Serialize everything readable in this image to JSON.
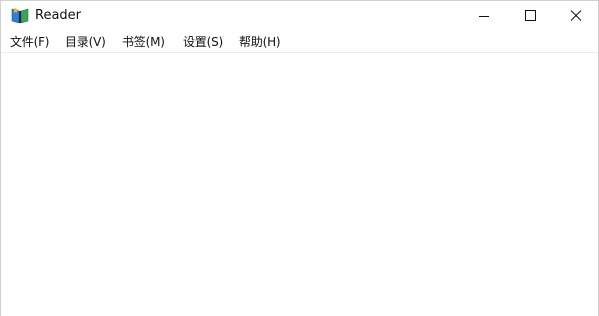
{
  "window": {
    "title": "Reader",
    "icon": "book-icon"
  },
  "window_controls": {
    "minimize": "minimize-icon",
    "maximize": "maximize-icon",
    "close": "close-icon"
  },
  "menubar": {
    "items": [
      {
        "label": "文件(F)"
      },
      {
        "label": "目录(V)"
      },
      {
        "label": "书签(M)"
      },
      {
        "label": "设置(S)"
      },
      {
        "label": "帮助(H)"
      }
    ]
  }
}
